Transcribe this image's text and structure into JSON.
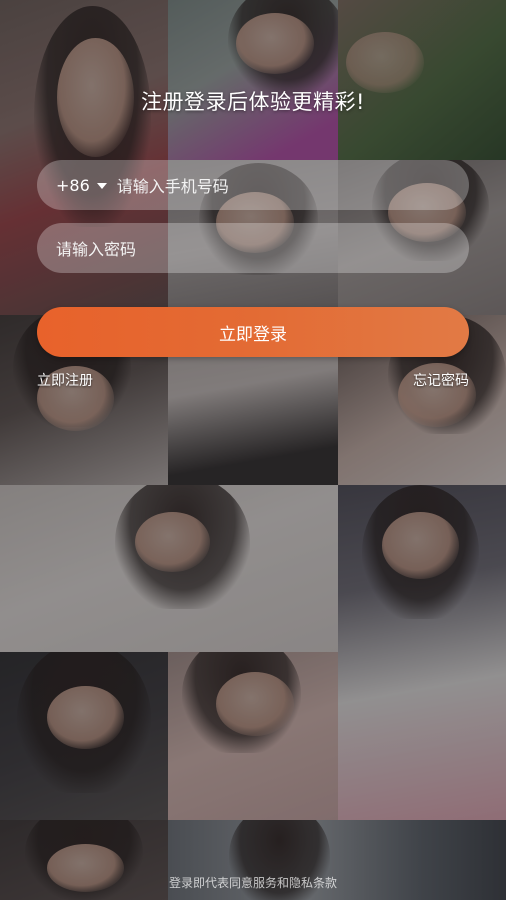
{
  "headline": "注册登录后体验更精彩!",
  "phone_field": {
    "country_code": "+86",
    "placeholder": "请输入手机号码"
  },
  "password_field": {
    "placeholder": "请输入密码"
  },
  "login_button": "立即登录",
  "register_link": "立即注册",
  "forgot_link": "忘记密码",
  "terms": "登录即代表同意服务和隐私条款",
  "colors": {
    "accent": "#e8622b",
    "field_bg": "rgba(255,255,255,0.28)"
  }
}
